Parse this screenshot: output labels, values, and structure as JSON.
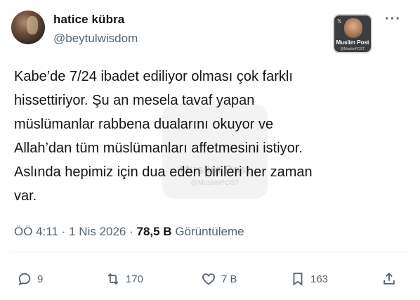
{
  "author": {
    "name": "hatice kübra",
    "handle": "@beytulwisdom"
  },
  "badge": {
    "brand": "Muslim Post",
    "sub": "@MuslimPOST",
    "x_mark": "𝕏"
  },
  "watermark": {
    "brand": "Muslim Post",
    "sub": "@MuslimPOST"
  },
  "post": {
    "lines": [
      "Kabe’de 7/24 ibadet ediliyor olması çok farklı",
      "hissettiriyor. Şu an mesela tavaf yapan",
      "müslümanlar rabbena dualarını okuyor ve",
      "Allah’dan tüm müslümanları affetmesini istiyor.",
      "Aslında hepimiz için dua eden birileri her zaman",
      "var."
    ]
  },
  "meta": {
    "time": "ÖÖ 4:11",
    "sep1": " · ",
    "date": "1 Nis 2026",
    "sep2": " · ",
    "views": "78,5 B",
    "views_label": " Görüntüleme"
  },
  "actions": {
    "replies": "9",
    "reposts": "170",
    "likes": "7 B",
    "bookmarks": "163"
  },
  "icons": {
    "more": "more-icon",
    "reply": "reply-icon",
    "repost": "repost-icon",
    "like": "heart-icon",
    "bookmark": "bookmark-icon",
    "share": "share-icon"
  },
  "colors": {
    "text": "#0f1419",
    "secondary": "#536471",
    "background": "#ffffff"
  }
}
